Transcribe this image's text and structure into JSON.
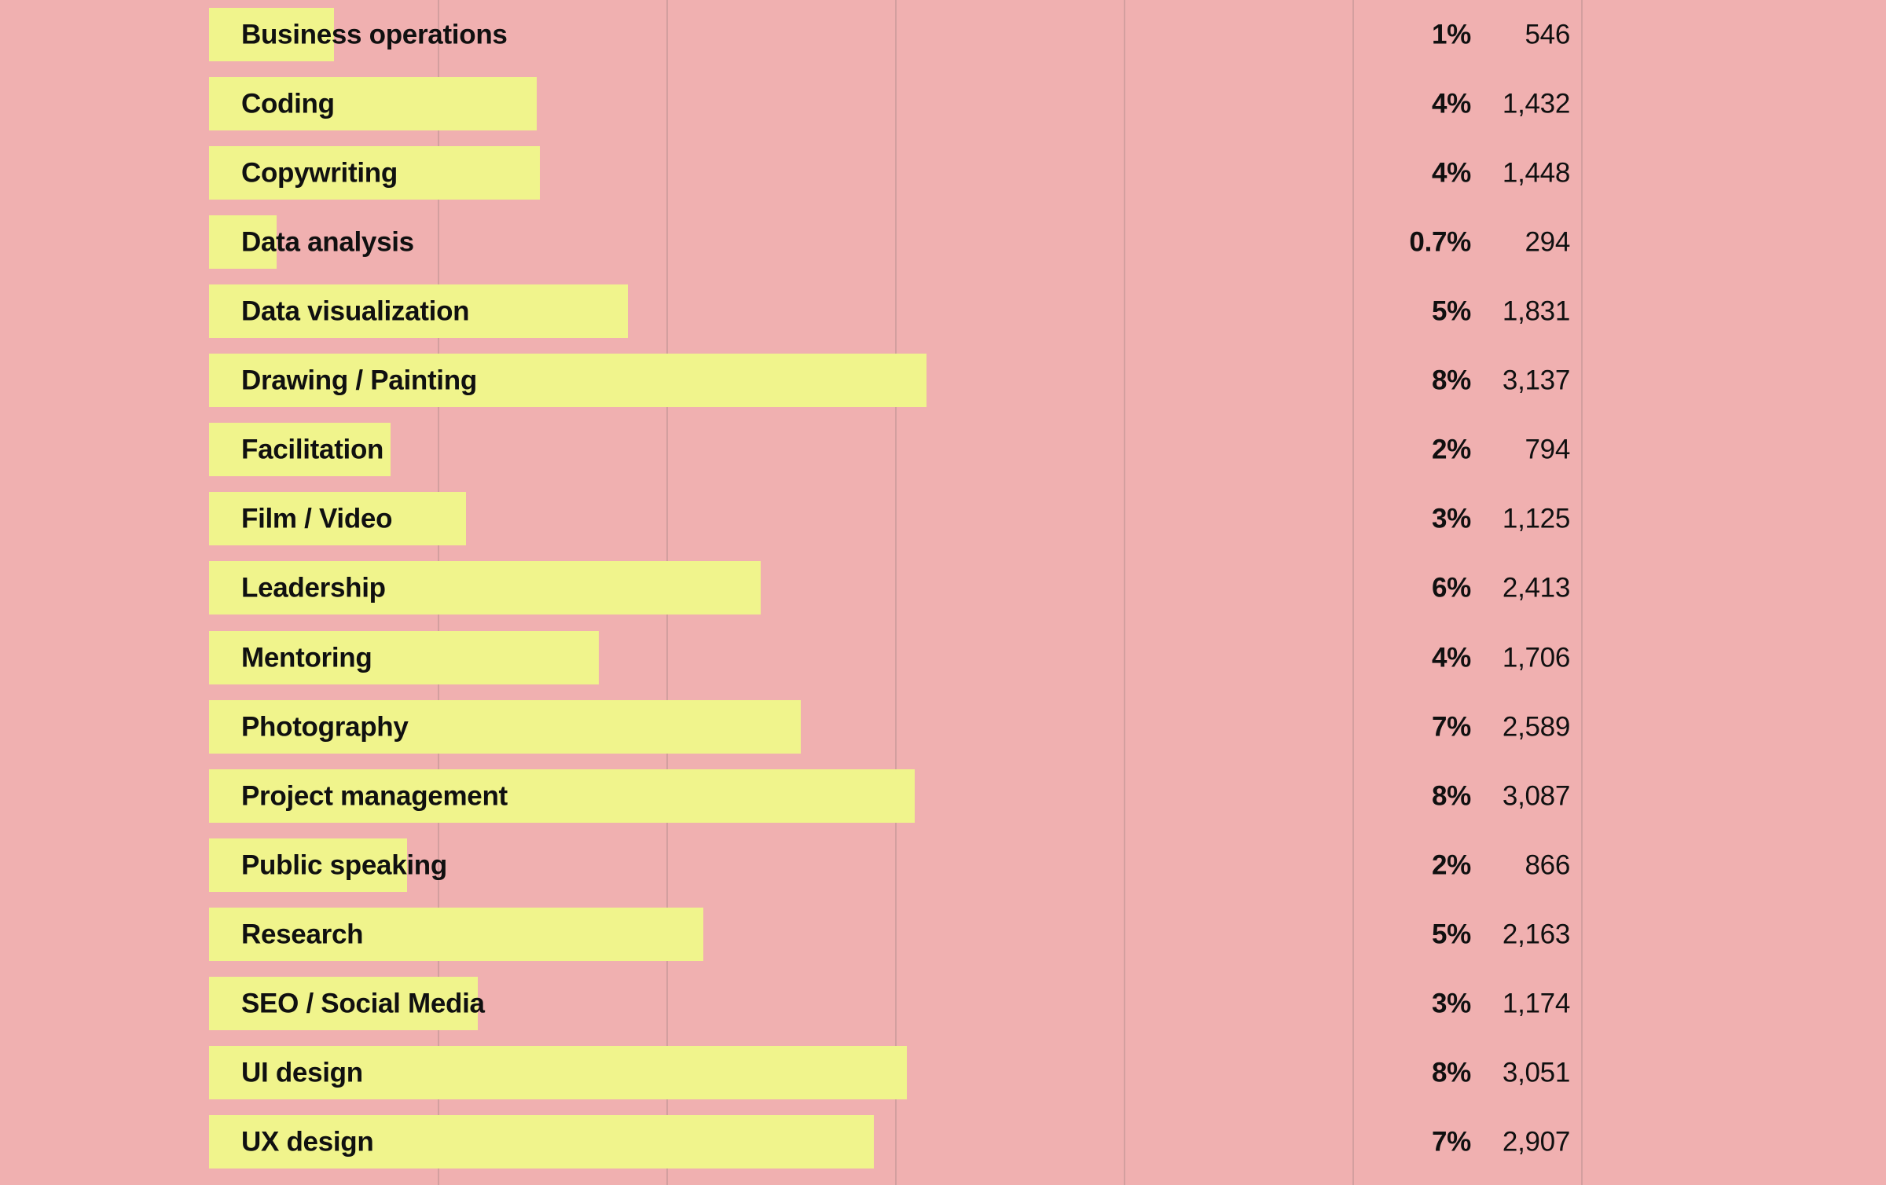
{
  "chart_data": {
    "type": "bar",
    "title": "",
    "subtitle": "",
    "xlabel": "",
    "ylabel": "",
    "orientation": "horizontal",
    "grid": true,
    "legend": null,
    "axis": {
      "x_min": 0,
      "x_max": 6000,
      "gridline_step": 1000,
      "gridline_values": [
        1000,
        2000,
        3000,
        4000,
        5000,
        6000
      ]
    },
    "value_columns": [
      "percent",
      "count"
    ],
    "categories": [
      "Business operations",
      "Coding",
      "Copywriting",
      "Data analysis",
      "Data visualization",
      "Drawing / Painting",
      "Facilitation",
      "Film / Video",
      "Leadership",
      "Mentoring",
      "Photography",
      "Project management",
      "Public speaking",
      "Research",
      "SEO / Social Media",
      "UI design",
      "UX design"
    ],
    "values": [
      546,
      1432,
      1448,
      294,
      1831,
      3137,
      794,
      1125,
      2413,
      1706,
      2589,
      3087,
      866,
      2163,
      1174,
      3051,
      2907
    ],
    "percents": [
      "1%",
      "4%",
      "4%",
      "0.7%",
      "5%",
      "8%",
      "2%",
      "3%",
      "6%",
      "4%",
      "7%",
      "8%",
      "2%",
      "5%",
      "3%",
      "8%",
      "7%"
    ],
    "count_labels": [
      "546",
      "1,432",
      "1,448",
      "294",
      "1,831",
      "3,137",
      "794",
      "1,125",
      "2,413",
      "1,706",
      "2,589",
      "3,087",
      "866",
      "2,163",
      "1,174",
      "3,051",
      "2,907"
    ],
    "rows": [
      {
        "label": "Business operations",
        "percent": "1%",
        "count": "546",
        "value": 546
      },
      {
        "label": "Coding",
        "percent": "4%",
        "count": "1,432",
        "value": 1432
      },
      {
        "label": "Copywriting",
        "percent": "4%",
        "count": "1,448",
        "value": 1448
      },
      {
        "label": "Data analysis",
        "percent": "0.7%",
        "count": "294",
        "value": 294
      },
      {
        "label": "Data visualization",
        "percent": "5%",
        "count": "1,831",
        "value": 1831
      },
      {
        "label": "Drawing / Painting",
        "percent": "8%",
        "count": "3,137",
        "value": 3137
      },
      {
        "label": "Facilitation",
        "percent": "2%",
        "count": "794",
        "value": 794
      },
      {
        "label": "Film / Video",
        "percent": "3%",
        "count": "1,125",
        "value": 1125
      },
      {
        "label": "Leadership",
        "percent": "6%",
        "count": "2,413",
        "value": 2413
      },
      {
        "label": "Mentoring",
        "percent": "4%",
        "count": "1,706",
        "value": 1706
      },
      {
        "label": "Photography",
        "percent": "7%",
        "count": "2,589",
        "value": 2589
      },
      {
        "label": "Project management",
        "percent": "8%",
        "count": "3,087",
        "value": 3087
      },
      {
        "label": "Public speaking",
        "percent": "2%",
        "count": "866",
        "value": 866
      },
      {
        "label": "Research",
        "percent": "5%",
        "count": "2,163",
        "value": 2163
      },
      {
        "label": "SEO / Social Media",
        "percent": "3%",
        "count": "1,174",
        "value": 1174
      },
      {
        "label": "UI design",
        "percent": "8%",
        "count": "3,051",
        "value": 3051
      },
      {
        "label": "UX design",
        "percent": "7%",
        "count": "2,907",
        "value": 2907
      }
    ]
  },
  "colors": {
    "background": "#F0B0B0",
    "bar": "#F0F48C",
    "gridline": "#C99A9A",
    "text": "#101010"
  }
}
